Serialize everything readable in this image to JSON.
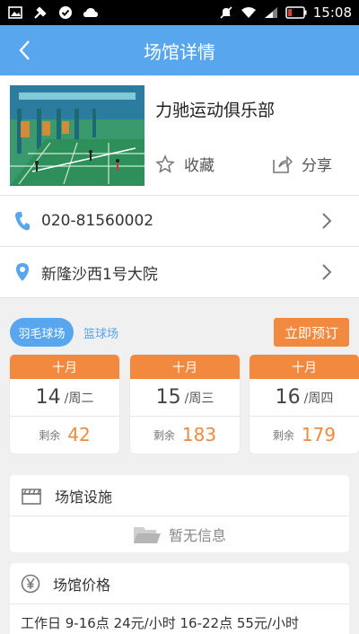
{
  "status_bar": {
    "time": "15:08"
  },
  "nav": {
    "title": "场馆详情"
  },
  "venue": {
    "name": "力驰运动俱乐部",
    "favorite_label": "收藏",
    "share_label": "分享",
    "phone": "020-81560002",
    "address": "新隆沙西1号大院"
  },
  "tabs": {
    "items": [
      {
        "label": "羽毛球场"
      },
      {
        "label": "篮球场"
      }
    ],
    "book_label": "立即预订"
  },
  "dates": [
    {
      "month": "十月",
      "day": "14",
      "weekday": "/周二",
      "remain_label": "剩余",
      "remain": "42"
    },
    {
      "month": "十月",
      "day": "15",
      "weekday": "/周三",
      "remain_label": "剩余",
      "remain": "183"
    },
    {
      "month": "十月",
      "day": "16",
      "weekday": "/周四",
      "remain_label": "剩余",
      "remain": "179"
    }
  ],
  "facilities": {
    "title": "场馆设施",
    "empty_text": "暂无信息"
  },
  "price": {
    "title": "场馆价格",
    "text": "工作日 9-16点 24元/小时 16-22点 55元/小时"
  },
  "colors": {
    "primary": "#58a6ee",
    "accent": "#f1893f"
  }
}
